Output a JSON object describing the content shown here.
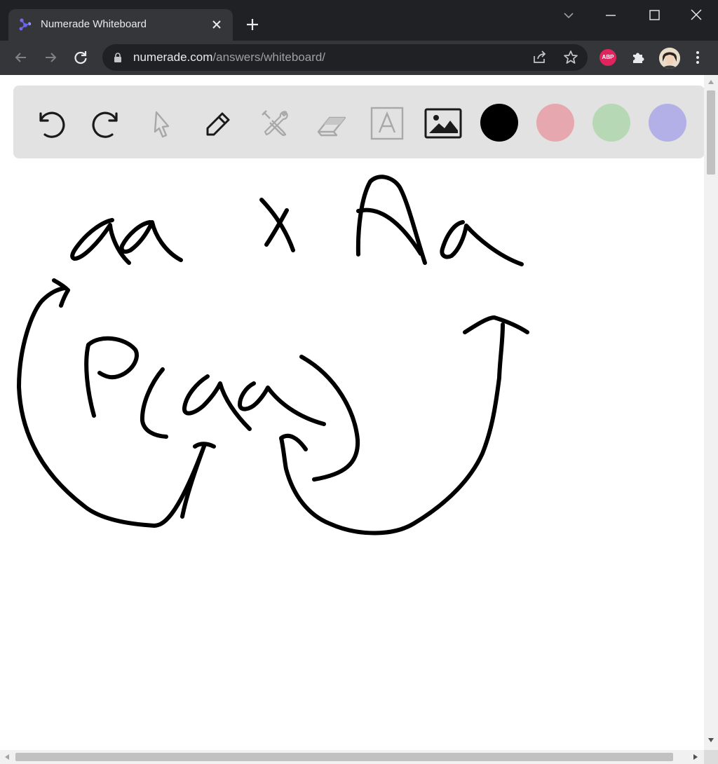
{
  "browser": {
    "tab_title": "Numerade Whiteboard",
    "url_host": "numerade.com",
    "url_path": "/answers/whiteboard/",
    "abp_label": "ABP"
  },
  "whiteboard": {
    "tools": [
      "undo-icon",
      "redo-icon",
      "select-pointer-icon",
      "pencil-icon",
      "tools-icon",
      "eraser-icon",
      "text-icon",
      "image-icon"
    ],
    "disabled_tools": [
      "select-pointer-icon",
      "tools-icon",
      "eraser-icon",
      "text-icon"
    ],
    "colors": [
      "#000000",
      "#e6a8ae",
      "#b6d8b4",
      "#b3b0e8"
    ],
    "ink_color": "#000000"
  }
}
